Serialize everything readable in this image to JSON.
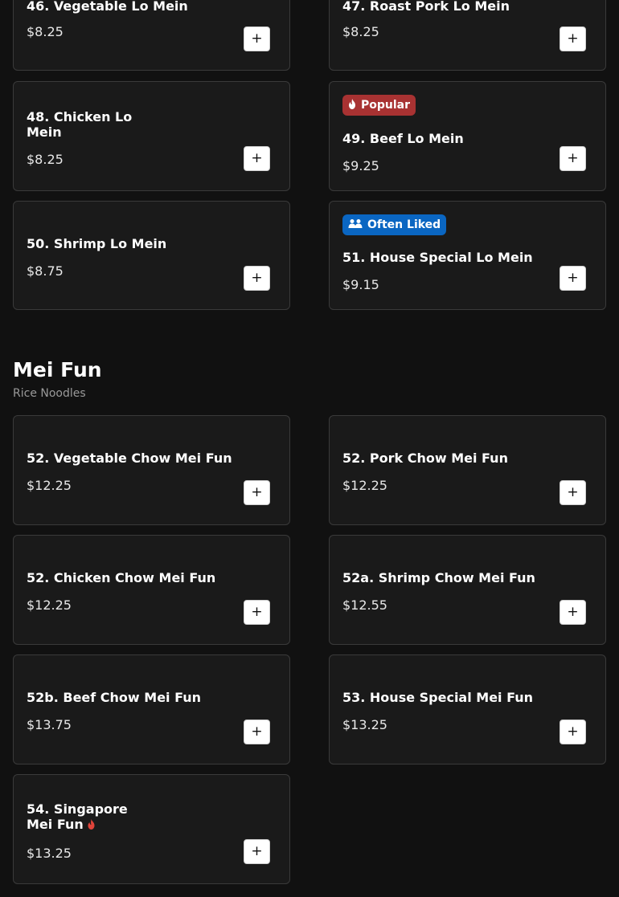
{
  "add_button_label": "+",
  "lo_mein_items": [
    {
      "name": "46. Vegetable Lo Mein",
      "price": "$8.25"
    },
    {
      "name": "47. Roast Pork Lo Mein",
      "price": "$8.25"
    },
    {
      "name": "48. Chicken Lo Mein",
      "price": "$8.25"
    },
    {
      "name": "49. Beef Lo Mein",
      "price": "$9.25",
      "badge": "Popular"
    },
    {
      "name": "50. Shrimp Lo Mein",
      "price": "$8.75"
    },
    {
      "name": "51. House Special Lo Mein",
      "price": "$9.15",
      "badge": "Often Liked"
    }
  ],
  "mei_fun": {
    "title": "Mei Fun",
    "subtitle": "Rice Noodles",
    "items": [
      {
        "name": "52. Vegetable Chow Mei Fun",
        "price": "$12.25"
      },
      {
        "name": "52. Pork Chow Mei Fun",
        "price": "$12.25"
      },
      {
        "name": "52. Chicken Chow Mei Fun",
        "price": "$12.25"
      },
      {
        "name": "52a. Shrimp Chow Mei Fun",
        "price": "$12.55"
      },
      {
        "name": "52b. Beef Chow Mei Fun",
        "price": "$13.75"
      },
      {
        "name": "53. House Special Mei Fun",
        "price": "$13.25"
      },
      {
        "name": "54. Singapore Mei Fun",
        "price": "$13.25",
        "spicy_icon": "fire-icon"
      }
    ]
  },
  "badge_colors": {
    "popular": "#a83232",
    "often_liked": "#0a66c2"
  },
  "icons": {
    "popular": "fire-icon",
    "often_liked": "people-icon",
    "add": "plus-icon"
  }
}
